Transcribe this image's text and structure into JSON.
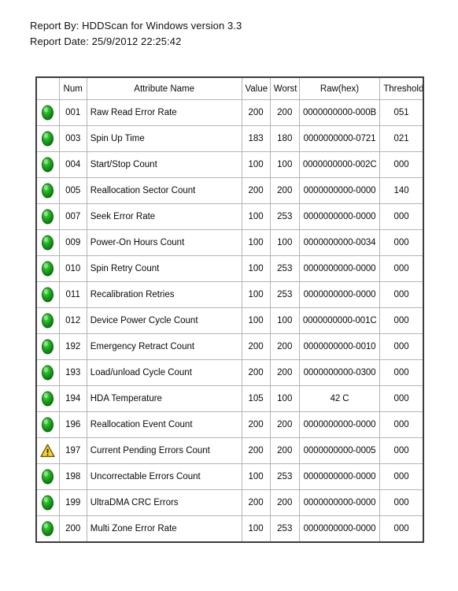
{
  "report": {
    "by_line": "Report By: HDDScan for Windows version 3.3",
    "date_line": "Report Date: 25/9/2012 22:25:42"
  },
  "table": {
    "columns": [
      {
        "key": "status",
        "label": ""
      },
      {
        "key": "num",
        "label": "Num"
      },
      {
        "key": "name",
        "label": "Attribute Name"
      },
      {
        "key": "value",
        "label": "Value"
      },
      {
        "key": "worst",
        "label": "Worst"
      },
      {
        "key": "raw",
        "label": "Raw(hex)"
      },
      {
        "key": "threshold",
        "label": "Threshold"
      }
    ],
    "status_colors": {
      "ok": "#1aa01a",
      "ok_dark": "#0d6b12",
      "ok_light": "#5fd95f",
      "warn": "#f2c319",
      "warn_dark": "#8a6b00",
      "warn_light": "#ffe680"
    },
    "rows": [
      {
        "status": "ok",
        "status_icon": "green-oval-ok-icon",
        "num": "001",
        "name": "Raw Read Error Rate",
        "value": "200",
        "worst": "200",
        "raw": "0000000000-000B",
        "threshold": "051"
      },
      {
        "status": "ok",
        "status_icon": "green-oval-ok-icon",
        "num": "003",
        "name": "Spin Up Time",
        "value": "183",
        "worst": "180",
        "raw": "0000000000-0721",
        "threshold": "021"
      },
      {
        "status": "ok",
        "status_icon": "green-oval-ok-icon",
        "num": "004",
        "name": "Start/Stop Count",
        "value": "100",
        "worst": "100",
        "raw": "0000000000-002C",
        "threshold": "000"
      },
      {
        "status": "ok",
        "status_icon": "green-oval-ok-icon",
        "num": "005",
        "name": "Reallocation Sector Count",
        "value": "200",
        "worst": "200",
        "raw": "0000000000-0000",
        "threshold": "140"
      },
      {
        "status": "ok",
        "status_icon": "green-oval-ok-icon",
        "num": "007",
        "name": "Seek Error Rate",
        "value": "100",
        "worst": "253",
        "raw": "0000000000-0000",
        "threshold": "000"
      },
      {
        "status": "ok",
        "status_icon": "green-oval-ok-icon",
        "num": "009",
        "name": "Power-On Hours Count",
        "value": "100",
        "worst": "100",
        "raw": "0000000000-0034",
        "threshold": "000"
      },
      {
        "status": "ok",
        "status_icon": "green-oval-ok-icon",
        "num": "010",
        "name": "Spin Retry Count",
        "value": "100",
        "worst": "253",
        "raw": "0000000000-0000",
        "threshold": "000"
      },
      {
        "status": "ok",
        "status_icon": "green-oval-ok-icon",
        "num": "011",
        "name": "Recalibration Retries",
        "value": "100",
        "worst": "253",
        "raw": "0000000000-0000",
        "threshold": "000"
      },
      {
        "status": "ok",
        "status_icon": "green-oval-ok-icon",
        "num": "012",
        "name": "Device Power Cycle Count",
        "value": "100",
        "worst": "100",
        "raw": "0000000000-001C",
        "threshold": "000"
      },
      {
        "status": "ok",
        "status_icon": "green-oval-ok-icon",
        "num": "192",
        "name": "Emergency Retract Count",
        "value": "200",
        "worst": "200",
        "raw": "0000000000-0010",
        "threshold": "000"
      },
      {
        "status": "ok",
        "status_icon": "green-oval-ok-icon",
        "num": "193",
        "name": "Load/unload Cycle Count",
        "value": "200",
        "worst": "200",
        "raw": "0000000000-0300",
        "threshold": "000"
      },
      {
        "status": "ok",
        "status_icon": "green-oval-ok-icon",
        "num": "194",
        "name": "HDA Temperature",
        "value": "105",
        "worst": "100",
        "raw": "42 C",
        "threshold": "000"
      },
      {
        "status": "ok",
        "status_icon": "green-oval-ok-icon",
        "num": "196",
        "name": "Reallocation Event Count",
        "value": "200",
        "worst": "200",
        "raw": "0000000000-0000",
        "threshold": "000"
      },
      {
        "status": "warn",
        "status_icon": "yellow-warning-triangle-icon",
        "num": "197",
        "name": "Current Pending Errors Count",
        "value": "200",
        "worst": "200",
        "raw": "0000000000-0005",
        "threshold": "000"
      },
      {
        "status": "ok",
        "status_icon": "green-oval-ok-icon",
        "num": "198",
        "name": "Uncorrectable Errors Count",
        "value": "100",
        "worst": "253",
        "raw": "0000000000-0000",
        "threshold": "000"
      },
      {
        "status": "ok",
        "status_icon": "green-oval-ok-icon",
        "num": "199",
        "name": "UltraDMA CRC Errors",
        "value": "200",
        "worst": "200",
        "raw": "0000000000-0000",
        "threshold": "000"
      },
      {
        "status": "ok",
        "status_icon": "green-oval-ok-icon",
        "num": "200",
        "name": "Multi Zone Error Rate",
        "value": "100",
        "worst": "253",
        "raw": "0000000000-0000",
        "threshold": "000"
      }
    ]
  }
}
